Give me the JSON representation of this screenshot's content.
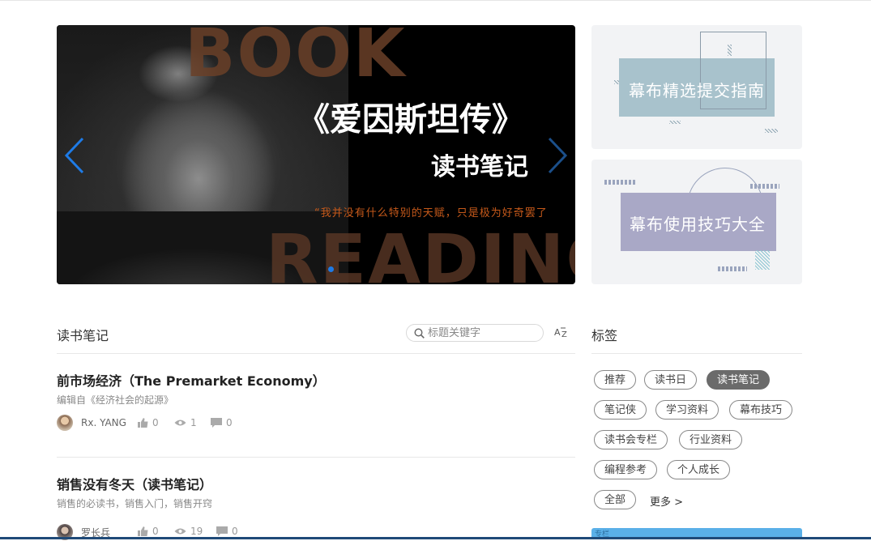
{
  "banner": {
    "bg_word_top": "BOOK",
    "bg_word_bottom": "READING",
    "title": "《爱因斯坦传》",
    "subtitle": "读书笔记",
    "quote": "“我并没有什么特别的天赋，只是极为好奇罢了",
    "active_slide": 1,
    "slide_count": 1,
    "arrow_color": "#1e7be6"
  },
  "side_cards": [
    {
      "label": "幕布精选提交指南",
      "color": "#a8c2cc"
    },
    {
      "label": "幕布使用技巧大全",
      "color": "#a9a8c6"
    }
  ],
  "notes_section": {
    "title": "读书笔记",
    "search_placeholder": "标题关键字",
    "sort_icon": "A↓Z"
  },
  "articles": [
    {
      "title": "前市场经济（The Premarket Economy）",
      "desc": "编辑自《经济社会的起源》",
      "author": "Rx. YANG",
      "likes": "0",
      "views": "1",
      "comments": "0"
    },
    {
      "title": "销售没有冬天（读书笔记）",
      "desc": "销售的必读书，销售入门，销售开窍",
      "author": "罗长兵",
      "likes": "0",
      "views": "19",
      "comments": "0"
    }
  ],
  "tags_section": {
    "title": "标签",
    "tags": [
      "推荐",
      "读书日",
      "读书笔记",
      "笔记侠",
      "学习资料",
      "幕布技巧",
      "读书会专栏",
      "行业资料",
      "编程参考",
      "个人成长",
      "全部"
    ],
    "active_tag": "读书笔记",
    "more_label": "更多 >"
  },
  "bottom_card_label": "专栏",
  "colors": {
    "accent": "#1e7be6",
    "active_tag_bg": "#6b6b6b"
  }
}
